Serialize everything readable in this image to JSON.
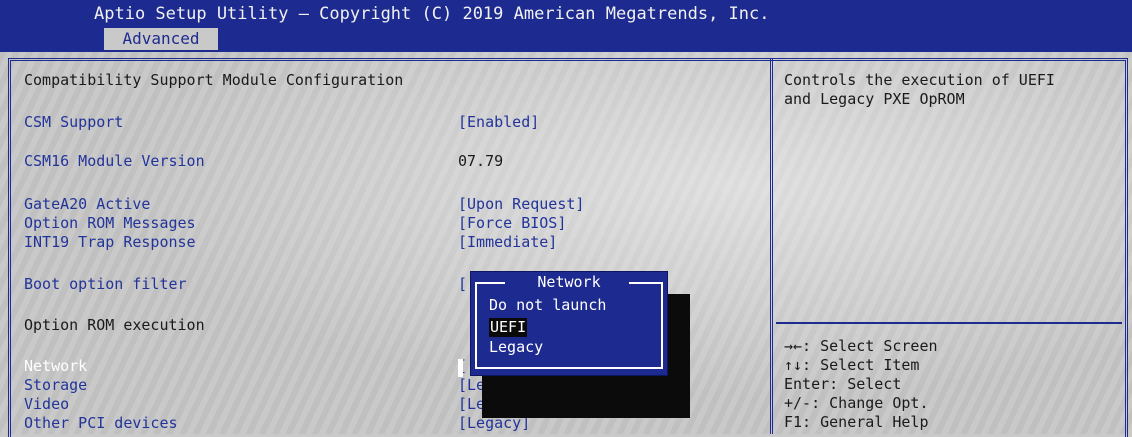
{
  "header": {
    "title": "Aptio Setup Utility – Copyright (C) 2019 American Megatrends, Inc.",
    "active_tab": "Advanced"
  },
  "main": {
    "section_title": "Compatibility Support Module Configuration",
    "settings": [
      {
        "label": "CSM Support",
        "value": "[Enabled]"
      },
      {
        "label": "CSM16 Module Version",
        "value": "07.79"
      },
      {
        "label": "GateA20 Active",
        "value": "[Upon Request]"
      },
      {
        "label": "Option ROM Messages",
        "value": "[Force BIOS]"
      },
      {
        "label": "INT19 Trap Response",
        "value": "[Immediate]"
      },
      {
        "label": "Boot option filter",
        "value": "["
      },
      {
        "label": "Option ROM execution",
        "value": ""
      },
      {
        "label": "Network",
        "value": "["
      },
      {
        "label": "Storage",
        "value": "[Le"
      },
      {
        "label": "Video",
        "value": "[Legacy]"
      },
      {
        "label": "Other PCI devices",
        "value": "[Legacy]"
      }
    ]
  },
  "popup": {
    "title": "Network",
    "options": [
      "Do not launch",
      "UEFI",
      "Legacy"
    ],
    "selected": "UEFI"
  },
  "help": {
    "description": "Controls the execution of UEFI\nand Legacy PXE OpROM",
    "keys": [
      "→←: Select Screen",
      "↑↓: Select Item",
      "Enter: Select",
      "+/-: Change Opt.",
      "F1: General Help"
    ]
  },
  "colors": {
    "bios_blue": "#1d2a8f",
    "panel_gray": "#c9c9c9",
    "highlight_white": "#ffffff"
  }
}
